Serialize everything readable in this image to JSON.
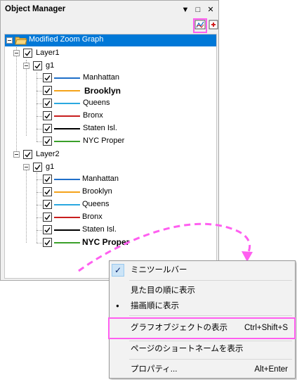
{
  "panel": {
    "title": "Object Manager",
    "buttons": {
      "dropdown": "▼",
      "restore": "□",
      "close": "✕"
    }
  },
  "toolbar": {
    "icons": [
      "graph-objects-icon",
      "add-icon"
    ]
  },
  "tree": {
    "root": "Modified Zoom Graph",
    "layers": [
      {
        "name": "Layer1",
        "group": "g1",
        "plots": [
          {
            "label": "Manhattan",
            "color": "#1f6fc9",
            "bold": false
          },
          {
            "label": "Brooklyn",
            "color": "#f5a31a",
            "bold": true
          },
          {
            "label": "Queens",
            "color": "#2aa8e0",
            "bold": false
          },
          {
            "label": "Bronx",
            "color": "#c81e1e",
            "bold": false
          },
          {
            "label": "Staten Isl.",
            "color": "#000000",
            "bold": false
          },
          {
            "label": "NYC Proper",
            "color": "#3aa02a",
            "bold": false
          }
        ]
      },
      {
        "name": "Layer2",
        "group": "g1",
        "plots": [
          {
            "label": "Manhattan",
            "color": "#1f6fc9",
            "bold": false
          },
          {
            "label": "Brooklyn",
            "color": "#f5a31a",
            "bold": false
          },
          {
            "label": "Queens",
            "color": "#2aa8e0",
            "bold": false
          },
          {
            "label": "Bronx",
            "color": "#c81e1e",
            "bold": false
          },
          {
            "label": "Staten Isl.",
            "color": "#000000",
            "bold": false
          },
          {
            "label": "NYC Proper",
            "color": "#3aa02a",
            "bold": true
          }
        ]
      }
    ]
  },
  "context_menu": {
    "items": [
      {
        "label": "ミニツールバー",
        "shortcut": "",
        "mark": "check"
      },
      {
        "label": "見た目の順に表示",
        "shortcut": "",
        "mark": ""
      },
      {
        "label": "描画順に表示",
        "shortcut": "",
        "mark": "dot"
      },
      {
        "label": "グラフオブジェクトの表示",
        "shortcut": "Ctrl+Shift+S",
        "mark": ""
      },
      {
        "label": "ページのショートネームを表示",
        "shortcut": "",
        "mark": ""
      },
      {
        "label": "プロパティ...",
        "shortcut": "Alt+Enter",
        "mark": ""
      }
    ],
    "check_glyph": "✓",
    "dot_glyph": "●"
  },
  "colors": {
    "highlight": "#ff5ff0",
    "selection": "#0078d7"
  }
}
